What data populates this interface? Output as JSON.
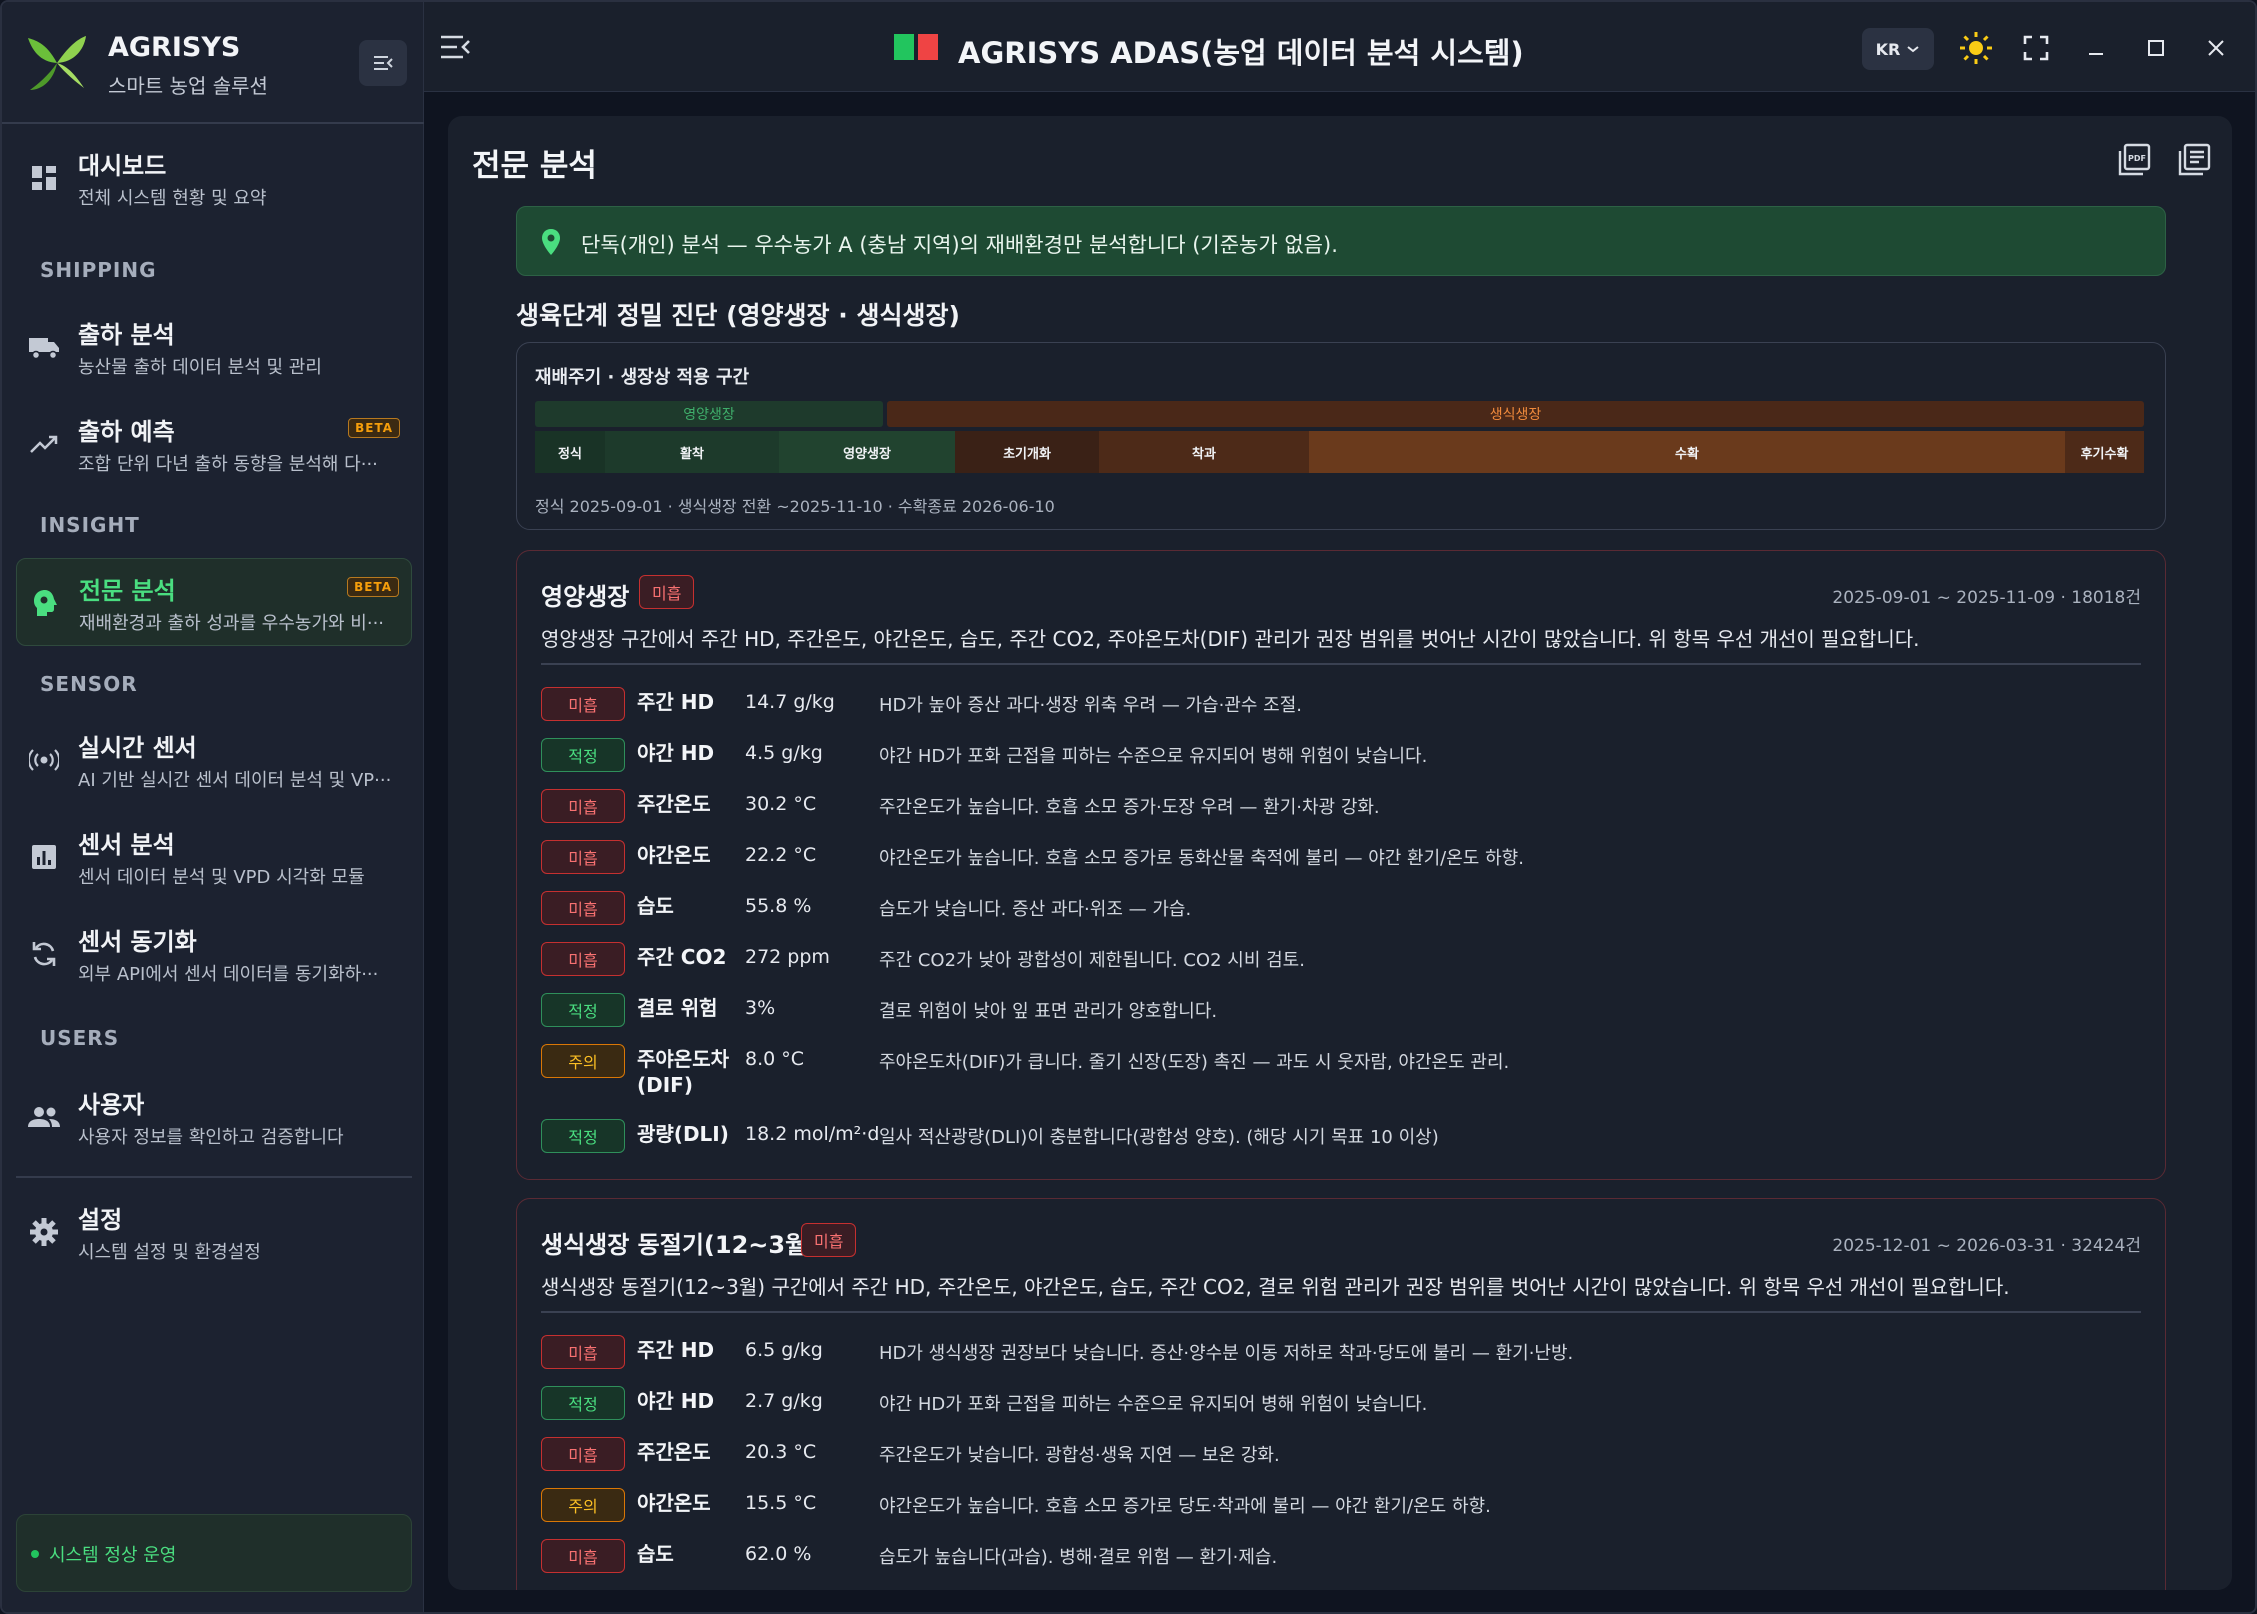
{
  "brand": {
    "name": "AGRISYS",
    "subtitle": "스마트 농업 솔루션"
  },
  "sidebar": {
    "dashboard": {
      "title": "대시보드",
      "sub": "전체 시스템 현황 및 요약"
    },
    "sections": {
      "shipping": "SHIPPING",
      "insight": "INSIGHT",
      "sensor": "SENSOR",
      "users": "USERS"
    },
    "items": [
      {
        "title": "출하 분석",
        "sub": "농산물 출하 데이터 분석 및 관리"
      },
      {
        "title": "출하 예측",
        "sub": "조합 단위 다년 출하 동향을 분석해 다···",
        "badge": "BETA"
      },
      {
        "title": "전문 분석",
        "sub": "재배환경과 출하 성과를 우수농가와 비···",
        "badge": "BETA"
      },
      {
        "title": "실시간 센서",
        "sub": "AI 기반 실시간 센서 데이터 분석 및 VP···"
      },
      {
        "title": "센서 분석",
        "sub": "센서 데이터 분석 및 VPD 시각화 모듈"
      },
      {
        "title": "센서 동기화",
        "sub": "외부 API에서 센서 데이터를 동기화하···"
      },
      {
        "title": "사용자",
        "sub": "사용자 정보를 확인하고 검증합니다"
      },
      {
        "title": "설정",
        "sub": "시스템 설정 및 환경설정"
      }
    ],
    "status": "시스템 정상 운영"
  },
  "topbar": {
    "title": "AGRISYS ADAS(농업 데이터 분석 시스템)",
    "lang": "KR"
  },
  "page": {
    "title": "전문 분석",
    "alert": "단독(개인) 분석 — 우수농가 A (충남 지역)의 재배환경만 분석합니다 (기준농가 없음).",
    "section_title": "생육단계 정밀 진단 (영양생장 · 생식생장)"
  },
  "cycle": {
    "title": "재배주기 · 생장상 적용 구간",
    "phases": [
      "영양생장",
      "생식생장"
    ],
    "stages": [
      "정식",
      "활착",
      "영양생장",
      "초기개화",
      "착과",
      "수확",
      "후기수확"
    ],
    "footer": "정식 2025-09-01 · 생식생장 전환 ~2025-11-10 · 수확종료 2026-06-10"
  },
  "cards": [
    {
      "title": "영양생장",
      "badge": "미흡",
      "meta": "2025-09-01 ~ 2025-11-09 · 18018건",
      "summary": "영양생장 구간에서 주간 HD, 주간온도, 야간온도, 습도, 주간 CO2, 주야온도차(DIF) 관리가 권장 범위를 벗어난 시간이 많았습니다. 위 항목 우선 개선이 필요합니다.",
      "metrics": [
        {
          "status": "미흡",
          "level": "bad",
          "name": "주간 HD",
          "value": "14.7 g/kg",
          "desc": "HD가 높아 증산 과다·생장 위축 우려 — 가습·관수 조절."
        },
        {
          "status": "적정",
          "level": "ok",
          "name": "야간 HD",
          "value": "4.5 g/kg",
          "desc": "야간 HD가 포화 근접을 피하는 수준으로 유지되어 병해 위험이 낮습니다."
        },
        {
          "status": "미흡",
          "level": "bad",
          "name": "주간온도",
          "value": "30.2 °C",
          "desc": "주간온도가 높습니다. 호흡 소모 증가·도장 우려 — 환기·차광 강화."
        },
        {
          "status": "미흡",
          "level": "bad",
          "name": "야간온도",
          "value": "22.2 °C",
          "desc": "야간온도가 높습니다. 호흡 소모 증가로 동화산물 축적에 불리 — 야간 환기/온도 하향."
        },
        {
          "status": "미흡",
          "level": "bad",
          "name": "습도",
          "value": "55.8 %",
          "desc": "습도가 낮습니다. 증산 과다·위조 — 가습."
        },
        {
          "status": "미흡",
          "level": "bad",
          "name": "주간 CO2",
          "value": "272 ppm",
          "desc": "주간 CO2가 낮아 광합성이 제한됩니다. CO2 시비 검토."
        },
        {
          "status": "적정",
          "level": "ok",
          "name": "결로 위험",
          "value": "3%",
          "desc": "결로 위험이 낮아 잎 표면 관리가 양호합니다."
        },
        {
          "status": "주의",
          "level": "warn",
          "name": "주야온도차 (DIF)",
          "value": "8.0 °C",
          "desc": "주야온도차(DIF)가 큽니다. 줄기 신장(도장) 촉진 — 과도 시 웃자람, 야간온도 관리."
        },
        {
          "status": "적정",
          "level": "ok",
          "name": "광량(DLI)",
          "value": "18.2 mol/m²·d",
          "desc": "일사 적산광량(DLI)이 충분합니다(광합성 양호). (해당 시기 목표 10 이상)"
        }
      ]
    },
    {
      "title": "생식생장 동절기(12~3월)",
      "badge": "미흡",
      "meta": "2025-12-01 ~ 2026-03-31 · 32424건",
      "summary": "생식생장 동절기(12~3월) 구간에서 주간 HD, 주간온도, 야간온도, 습도, 주간 CO2, 결로 위험 관리가 권장 범위를 벗어난 시간이 많았습니다. 위 항목 우선 개선이 필요합니다.",
      "metrics": [
        {
          "status": "미흡",
          "level": "bad",
          "name": "주간 HD",
          "value": "6.5 g/kg",
          "desc": "HD가 생식생장 권장보다 낮습니다. 증산·양수분 이동 저하로 착과·당도에 불리 — 환기·난방."
        },
        {
          "status": "적정",
          "level": "ok",
          "name": "야간 HD",
          "value": "2.7 g/kg",
          "desc": "야간 HD가 포화 근접을 피하는 수준으로 유지되어 병해 위험이 낮습니다."
        },
        {
          "status": "미흡",
          "level": "bad",
          "name": "주간온도",
          "value": "20.3 °C",
          "desc": "주간온도가 낮습니다. 광합성·생육 지연 — 보온 강화."
        },
        {
          "status": "주의",
          "level": "warn",
          "name": "야간온도",
          "value": "15.5 °C",
          "desc": "야간온도가 높습니다. 호흡 소모 증가로 당도·착과에 불리 — 야간 환기/온도 하향."
        },
        {
          "status": "미흡",
          "level": "bad",
          "name": "습도",
          "value": "62.0 %",
          "desc": "습도가 높습니다(과습). 병해·결로 위험 — 환기·제습."
        }
      ]
    }
  ]
}
